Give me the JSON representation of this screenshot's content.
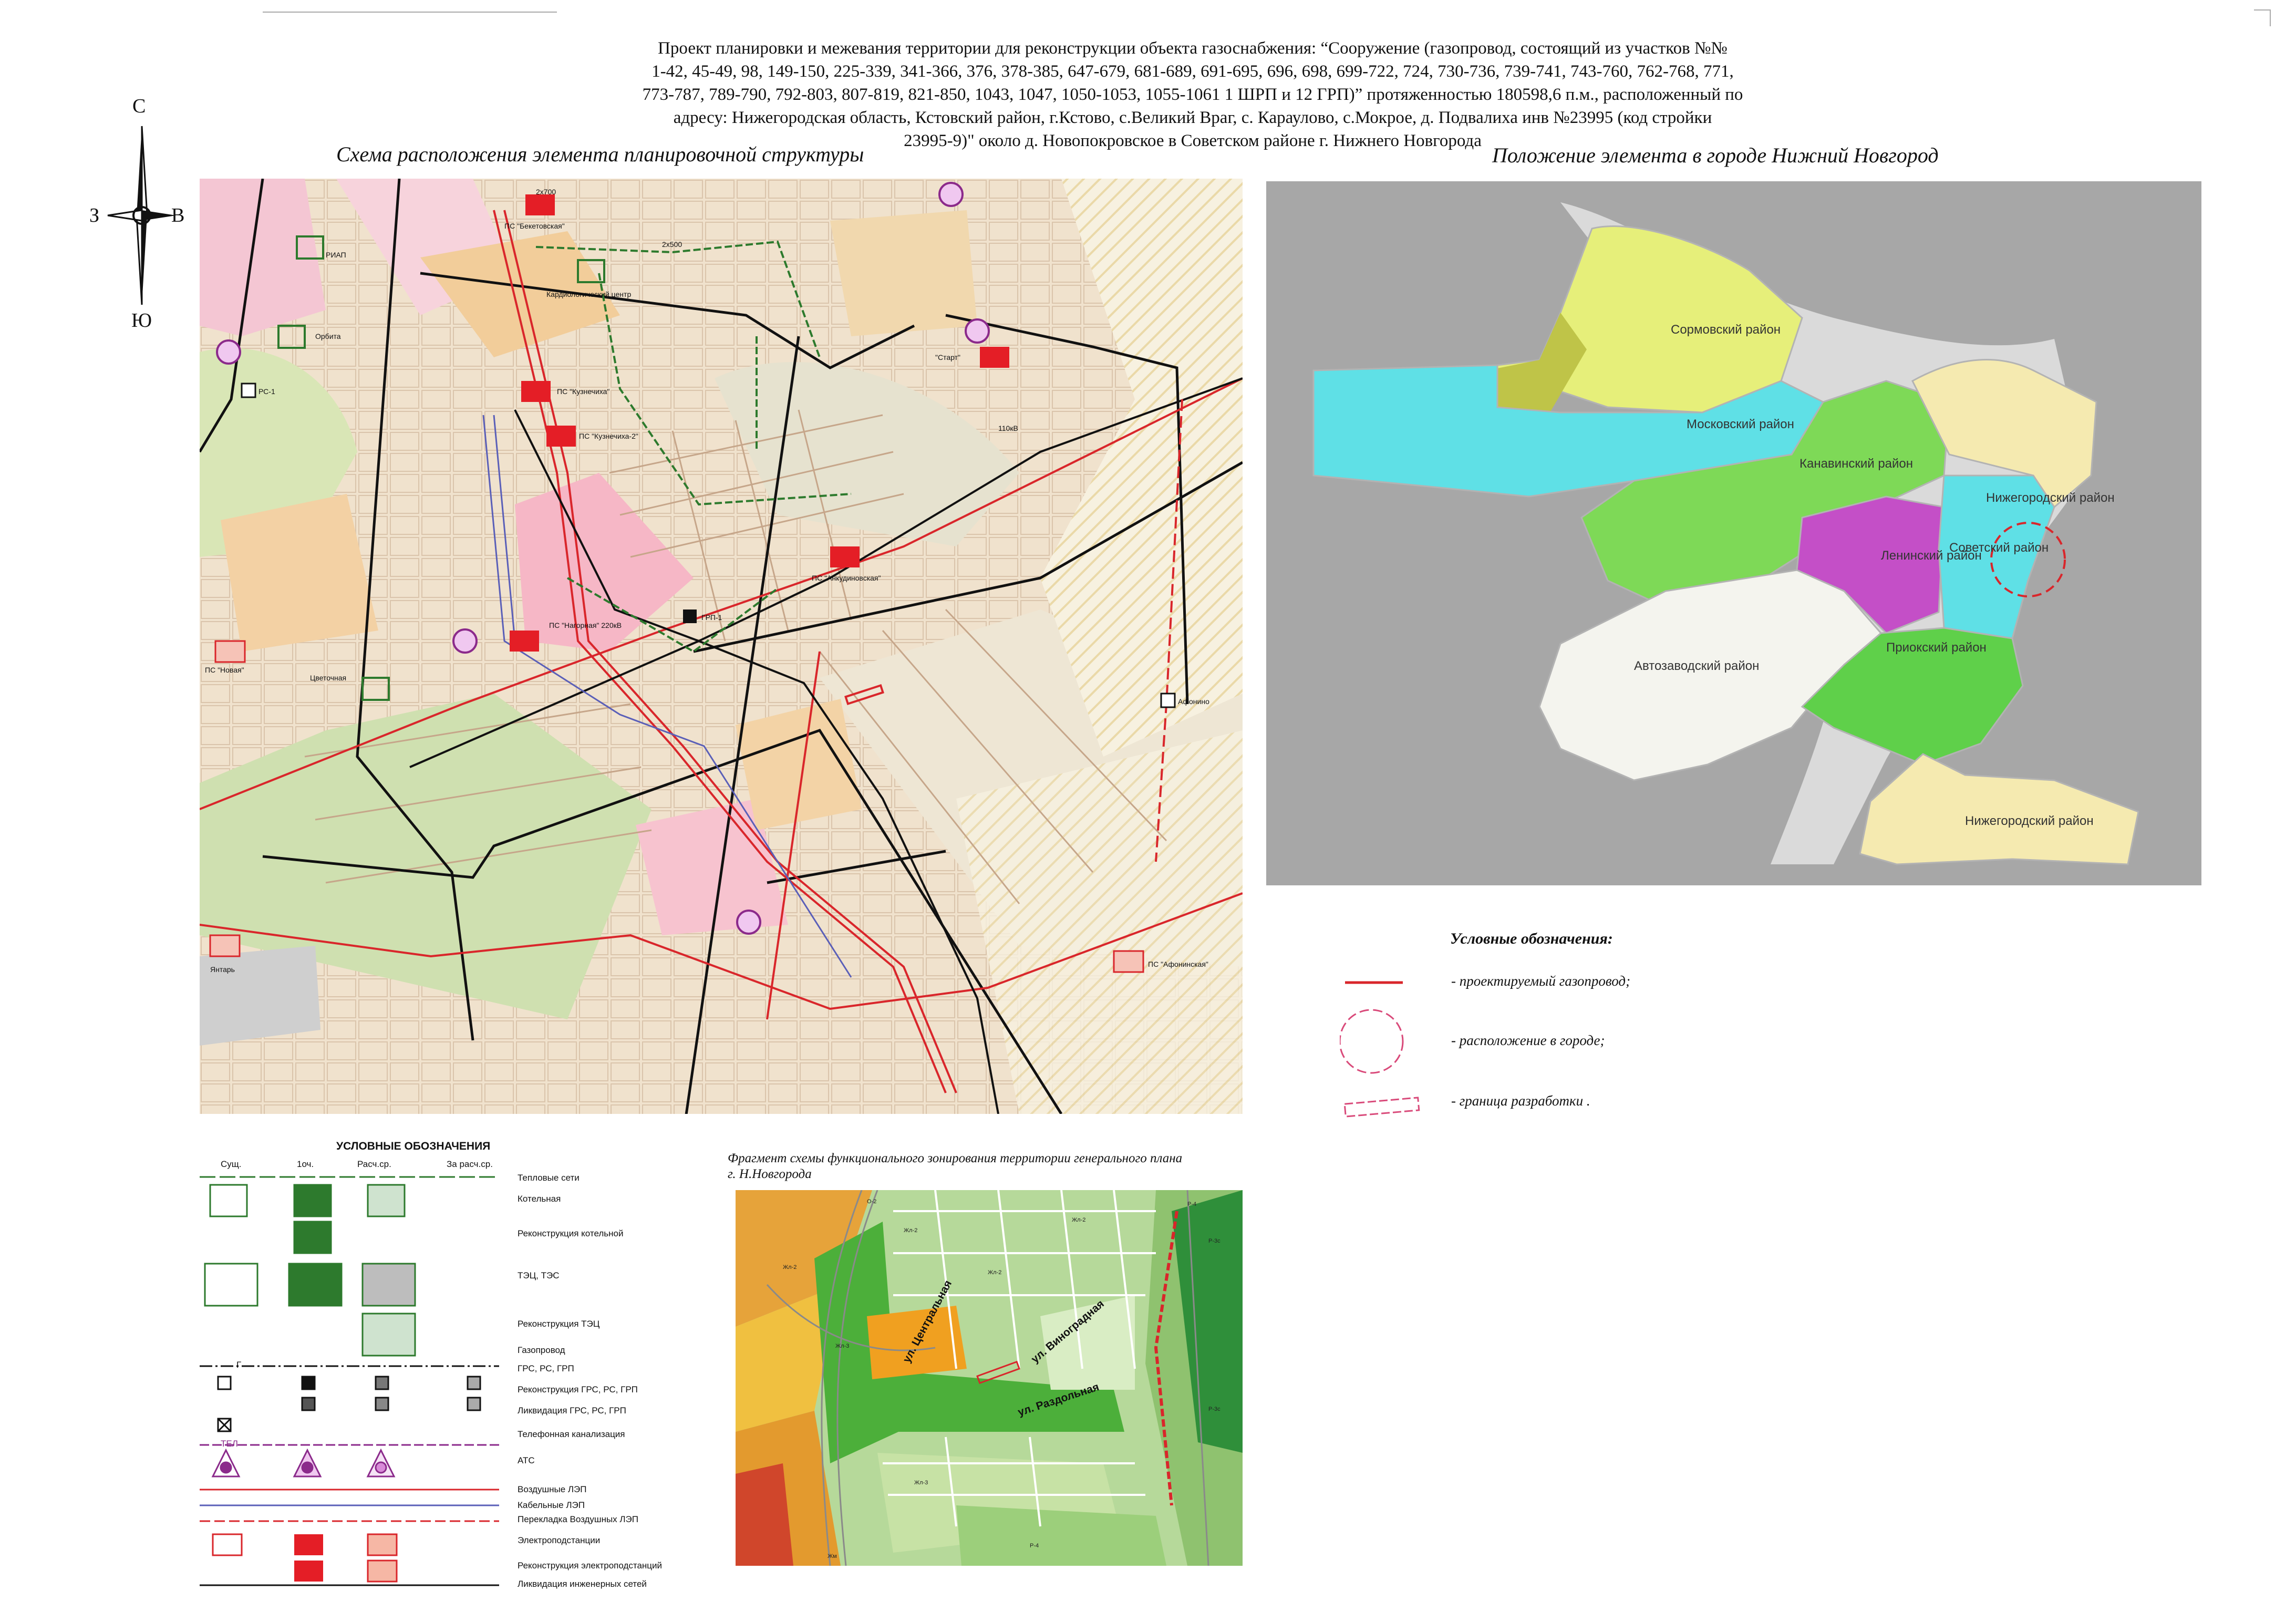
{
  "title": {
    "lines": [
      "Проект планировки и межевания территории для реконструкции  объекта газоснабжения: “Сооружение (газопровод, состоящий из участков №№",
      "1-42, 45-49, 98,  149-150, 225-339, 341-366, 376, 378-385, 647-679, 681-689, 691-695, 696, 698, 699-722, 724, 730-736, 739-741, 743-760, 762-768, 771,",
      "773-787, 789-790, 792-803, 807-819, 821-850, 1043, 1047, 1050-1053, 1055-1061 1 ШРП и 12 ГРП)” протяженностью 180598,6 п.м., расположенный по",
      "адресу: Нижегородская область, Кстовский район, г.Кстово, с.Великий Враг, с. Караулово, с.Мокрое, д. Подвалиха инв №23995 (код стройки",
      "23995-9)\" около д. Новопокровское в Советском районе г. Нижнего Новгорода"
    ]
  },
  "left_heading": "Схема расположения элемента планировочной структуры",
  "right_heading": "Положение элемента в городе Нижний Новгород",
  "compass": {
    "n": "С",
    "s": "Ю",
    "w": "З",
    "e": "В"
  },
  "scheme_labels": {
    "ps_beketovskaya": "ПС \"Бекетовская\"",
    "riap": "РИАП",
    "cardio": "Кардиологический центр",
    "orbita": "Орбита",
    "rs1": "РС-1",
    "ps_kuznechikha": "ПС \"Кузнечиха\"",
    "ps_kuznechikha2": "ПС \"Кузнечиха-2\"",
    "start": "\"Старт\"",
    "ps_ankudinovskaya": "ПС \"Анкудиновская\"",
    "grp": "ГРП-1",
    "ps_nagornaya": "ПС \"Нагорная\" 220кВ",
    "ps_novaya": "ПС \"Новая\"",
    "tsvetochnaya": "Цветочная",
    "afonino": "Афонино",
    "yantar": "Янтарь",
    "ps_afoninskaya": "ПС \"Афонинская\"",
    "line_110": "110кВ",
    "line_2x700": "2х700",
    "line_2x500": "2х500"
  },
  "districts": [
    {
      "name": "Сормовский район",
      "color": "#e6ef7a"
    },
    {
      "name": "Московский район",
      "color": "#5fe0e6"
    },
    {
      "name": "Канавинский район",
      "color": "#7ed957"
    },
    {
      "name": "Нижегородский район",
      "color": "#f5eab0"
    },
    {
      "name": "Ленинский район",
      "color": "#c44fc7"
    },
    {
      "name": "Советский район",
      "color": "#5fe0e6"
    },
    {
      "name": "Автозаводский район",
      "color": "#f4f4ee"
    },
    {
      "name": "Приокский район",
      "color": "#5fd04a"
    },
    {
      "name": "Нижегородский район",
      "color": "#f5eab0"
    }
  ],
  "right_legend": {
    "title": "Условные обозначения:",
    "items": [
      "- проектируемый газопровод;",
      "- расположение в городе;",
      "- граница разработки ."
    ]
  },
  "utility_legend": {
    "title": "УСЛОВНЫЕ ОБОЗНАЧЕНИЯ",
    "columns": [
      "Сущ.",
      "1оч.",
      "Расч.ср.",
      "За расч.ср."
    ],
    "rows": [
      "Тепловые сети",
      "Котельная",
      "Реконструкция котельной",
      "ТЭЦ, ТЭС",
      "Реконструкция ТЭЦ",
      "Газопровод",
      "ГРС, РС, ГРП",
      "Реконструкция ГРС, РС, ГРП",
      "Ликвидация ГРС, РС, ГРП",
      "Телефонная канализация",
      "АТС",
      "Воздушные ЛЭП",
      "Кабельные ЛЭП",
      "Перекладка Воздушных ЛЭП",
      "Электроподстанции",
      "Реконструкция электроподстанций",
      "Ликвидация инженерных сетей"
    ],
    "tel_label": "ТЕЛ",
    "gas_label": "Г"
  },
  "fragment": {
    "caption_lines": [
      "Фрагмент схемы функционального зонирования территории генерального плана",
      "г. Н.Новгорода"
    ],
    "streets": [
      "ул. Центральная",
      "ул. Виноградная",
      "ул. Раздольная"
    ],
    "zone_codes": [
      "Жл-2",
      "Жл-3",
      "Р-3с",
      "Р-4",
      "О-2",
      "Жм"
    ]
  }
}
